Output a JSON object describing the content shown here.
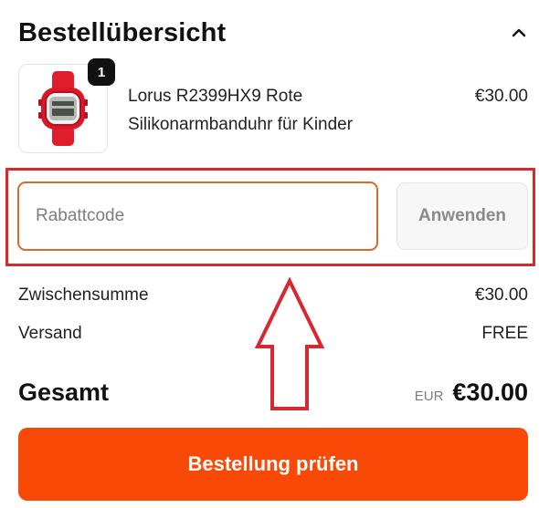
{
  "summary": {
    "title": "Bestellübersicht",
    "toggle_icon": "chevron-up-icon"
  },
  "product": {
    "image_icon": "red-kids-watch",
    "quantity": "1",
    "name": "Lorus R2399HX9 Rote Silikonarmbanduhr für Kinder",
    "price": "€30.00"
  },
  "discount": {
    "placeholder": "Rabattcode",
    "value": "",
    "apply_label": "Anwenden"
  },
  "totals": {
    "subtotal_label": "Zwischensumme",
    "subtotal_value": "€30.00",
    "shipping_label": "Versand",
    "shipping_value": "FREE",
    "total_label": "Gesamt",
    "total_currency": "EUR",
    "total_value": "€30.00"
  },
  "checkout": {
    "button_label": "Bestellung prüfen"
  },
  "annotation": {
    "highlight_icon": "red-outline-box",
    "arrow_icon": "red-up-arrow",
    "color": "#d7282f"
  },
  "colors": {
    "accent": "#f84a06",
    "input_border": "#d96a2b"
  }
}
